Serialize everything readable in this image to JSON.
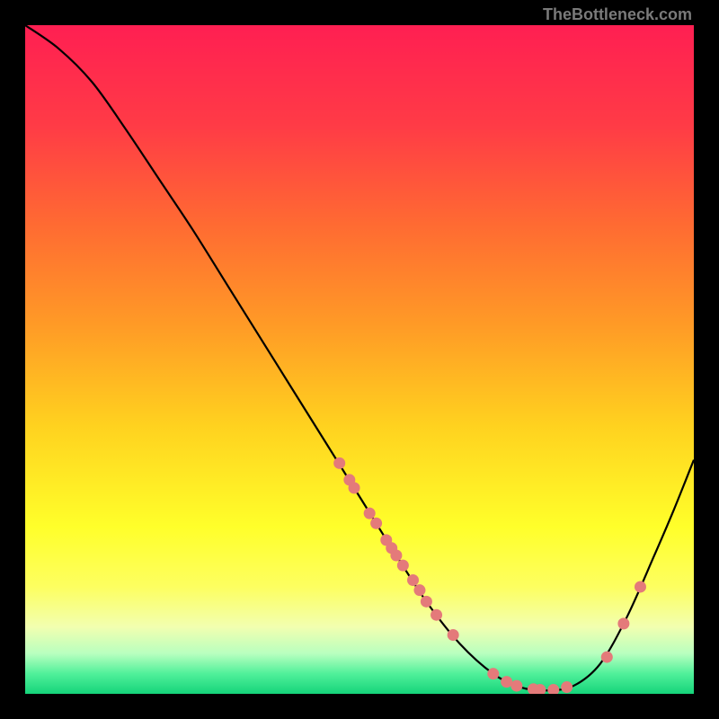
{
  "attribution": "TheBottleneck.com",
  "chart_data": {
    "type": "line",
    "title": "",
    "xlabel": "",
    "ylabel": "",
    "xlim": [
      0,
      1
    ],
    "ylim": [
      0,
      1
    ],
    "curve": [
      {
        "x": 0.0,
        "y": 1.0
      },
      {
        "x": 0.05,
        "y": 0.965
      },
      {
        "x": 0.1,
        "y": 0.915
      },
      {
        "x": 0.15,
        "y": 0.845
      },
      {
        "x": 0.2,
        "y": 0.77
      },
      {
        "x": 0.25,
        "y": 0.695
      },
      {
        "x": 0.3,
        "y": 0.615
      },
      {
        "x": 0.35,
        "y": 0.535
      },
      {
        "x": 0.4,
        "y": 0.455
      },
      {
        "x": 0.45,
        "y": 0.375
      },
      {
        "x": 0.5,
        "y": 0.295
      },
      {
        "x": 0.55,
        "y": 0.215
      },
      {
        "x": 0.6,
        "y": 0.138
      },
      {
        "x": 0.65,
        "y": 0.075
      },
      {
        "x": 0.7,
        "y": 0.03
      },
      {
        "x": 0.74,
        "y": 0.01
      },
      {
        "x": 0.78,
        "y": 0.005
      },
      {
        "x": 0.82,
        "y": 0.012
      },
      {
        "x": 0.86,
        "y": 0.045
      },
      {
        "x": 0.9,
        "y": 0.115
      },
      {
        "x": 0.94,
        "y": 0.205
      },
      {
        "x": 0.97,
        "y": 0.275
      },
      {
        "x": 1.0,
        "y": 0.35
      }
    ],
    "scatter": [
      {
        "x": 0.47,
        "y": 0.345
      },
      {
        "x": 0.485,
        "y": 0.32
      },
      {
        "x": 0.492,
        "y": 0.308
      },
      {
        "x": 0.515,
        "y": 0.27
      },
      {
        "x": 0.525,
        "y": 0.255
      },
      {
        "x": 0.54,
        "y": 0.23
      },
      {
        "x": 0.548,
        "y": 0.218
      },
      {
        "x": 0.555,
        "y": 0.207
      },
      {
        "x": 0.565,
        "y": 0.192
      },
      {
        "x": 0.58,
        "y": 0.17
      },
      {
        "x": 0.59,
        "y": 0.155
      },
      {
        "x": 0.6,
        "y": 0.138
      },
      {
        "x": 0.615,
        "y": 0.118
      },
      {
        "x": 0.64,
        "y": 0.088
      },
      {
        "x": 0.7,
        "y": 0.03
      },
      {
        "x": 0.72,
        "y": 0.018
      },
      {
        "x": 0.735,
        "y": 0.012
      },
      {
        "x": 0.76,
        "y": 0.007
      },
      {
        "x": 0.77,
        "y": 0.006
      },
      {
        "x": 0.79,
        "y": 0.006
      },
      {
        "x": 0.81,
        "y": 0.01
      },
      {
        "x": 0.87,
        "y": 0.055
      },
      {
        "x": 0.895,
        "y": 0.105
      },
      {
        "x": 0.92,
        "y": 0.16
      }
    ],
    "gradient_stops": [
      {
        "offset": 0.0,
        "color": "#ff1f52"
      },
      {
        "offset": 0.15,
        "color": "#ff3b46"
      },
      {
        "offset": 0.3,
        "color": "#ff6b32"
      },
      {
        "offset": 0.45,
        "color": "#ff9b26"
      },
      {
        "offset": 0.6,
        "color": "#ffd21f"
      },
      {
        "offset": 0.75,
        "color": "#ffff2a"
      },
      {
        "offset": 0.84,
        "color": "#fdff60"
      },
      {
        "offset": 0.9,
        "color": "#f2ffb0"
      },
      {
        "offset": 0.94,
        "color": "#b8ffbf"
      },
      {
        "offset": 0.97,
        "color": "#50f09a"
      },
      {
        "offset": 1.0,
        "color": "#15d47a"
      }
    ],
    "scatter_color": "#e47a7a",
    "curve_color": "#000000"
  }
}
